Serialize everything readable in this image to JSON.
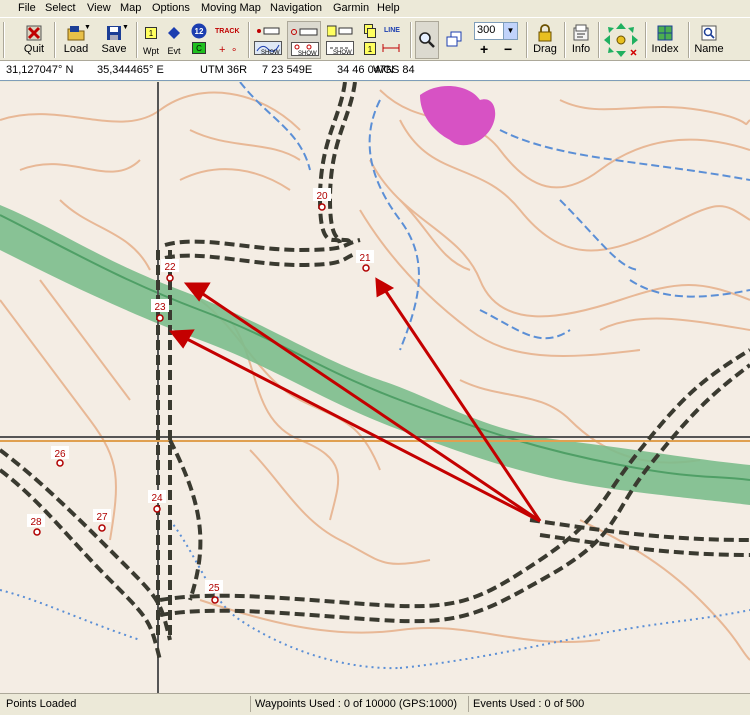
{
  "menu": [
    "File",
    "Select",
    "View",
    "Map",
    "Options",
    "Moving Map",
    "Navigation",
    "Garmin",
    "Help"
  ],
  "toolbar": {
    "quit": "Quit",
    "load": "Load",
    "save": "Save",
    "wpt": "Wpt",
    "evt": "Evt",
    "track": "TRACK",
    "show": "SHOW",
    "line": "LINE",
    "zoom_value": "300",
    "zoom_in": "+",
    "zoom_out": "−",
    "drag": "Drag",
    "info": "Info",
    "index": "Index",
    "name": "Name",
    "route_badge": "12"
  },
  "coords": {
    "lat": "31,127047° N",
    "lon": "35,344465° E",
    "utm": "UTM  36R",
    "easting": "7 23 549E",
    "northing": "34 46 047N",
    "datum": "WGS 84"
  },
  "waypoints": [
    {
      "label": "20"
    },
    {
      "label": "21"
    },
    {
      "label": "22"
    },
    {
      "label": "23"
    },
    {
      "label": "24"
    },
    {
      "label": "25"
    },
    {
      "label": "26"
    },
    {
      "label": "27"
    },
    {
      "label": "28"
    }
  ],
  "status": {
    "left": "Points Loaded",
    "middle": "Waypoints Used : 0 of 10000  (GPS:1000)",
    "right": "Events Used : 0 of 500"
  },
  "colors": {
    "arrow": "#c40000",
    "waypoint": "#b00000",
    "green_band": "#7cbc8c",
    "contour": "#e8b896",
    "track": "#3a3a30",
    "water": "#5b8fd6",
    "grid": "#555555"
  },
  "icons": {
    "quit": "quit-icon",
    "load": "folder-icon",
    "save": "floppy-icon",
    "zoom": "magnifier-icon",
    "drag": "lock-icon",
    "info": "info-icon",
    "pan": "pan-arrows-icon",
    "index": "index-icon",
    "name": "name-icon"
  }
}
